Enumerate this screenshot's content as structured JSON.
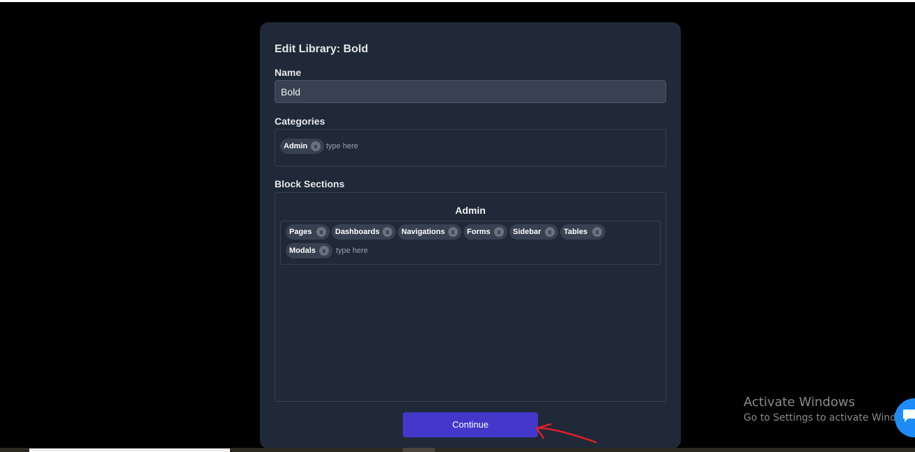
{
  "modal": {
    "title": "Edit Library: Bold",
    "name_label": "Name",
    "name_value": "Bold",
    "categories_label": "Categories",
    "categories": [
      "Admin"
    ],
    "categories_placeholder": "type here",
    "block_sections_label": "Block Sections",
    "section": {
      "title": "Admin",
      "tags": [
        "Pages",
        "Dashboards",
        "Navigations",
        "Forms",
        "Sidebar",
        "Tables",
        "Modals"
      ],
      "placeholder": "type here"
    },
    "tag_remove_glyph": "x",
    "continue_label": "Continue"
  },
  "watermark": {
    "title": "Activate Windows",
    "subtitle": "Go to Settings to activate Windows."
  },
  "colors": {
    "modal_bg": "#1f2937",
    "input_bg": "#374151",
    "button_bg": "#4338ca",
    "chat_bubble": "#1d8cf8",
    "annotation_arrow": "#e11d2a"
  },
  "icons": {
    "tag_remove": "close-icon",
    "chat": "chat-icon",
    "annotation": "hand-drawn-arrow"
  }
}
